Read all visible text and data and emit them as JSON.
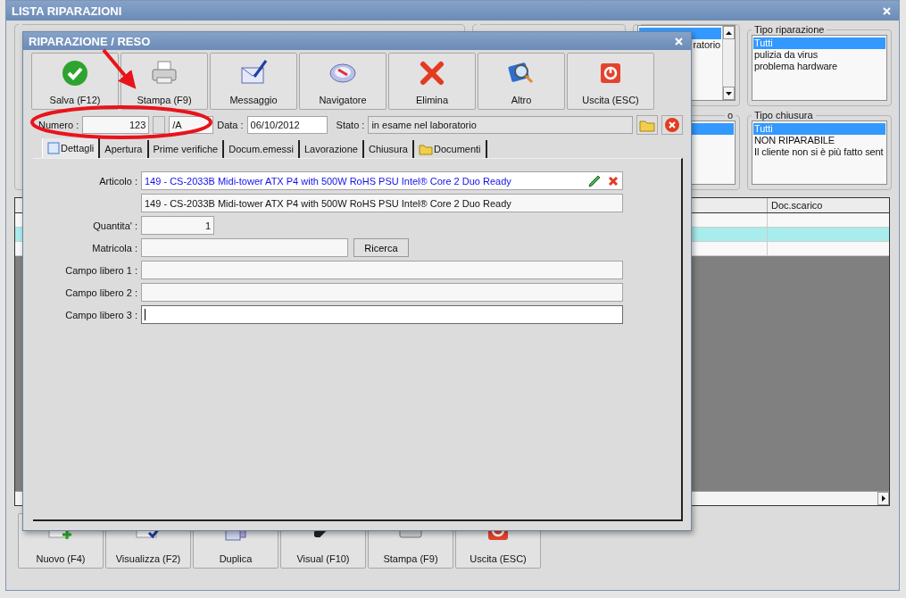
{
  "main_window": {
    "title": "LISTA RIPARAZIONI",
    "status_group": {
      "items": [
        {
          "selected": true
        },
        {
          "label": "ratorio",
          "selected": false
        }
      ]
    },
    "repair_type_group": {
      "title": "Tipo riparazione",
      "items": [
        {
          "label": "Tutti",
          "selected": true
        },
        {
          "label": "pulizia da virus",
          "selected": false
        },
        {
          "label": "problema hardware",
          "selected": false
        }
      ]
    },
    "second_group": {
      "title": "o",
      "items": [
        {
          "selected": true
        }
      ]
    },
    "closure_type_group": {
      "title": "Tipo chiusura",
      "items": [
        {
          "label": "Tutti",
          "selected": true
        },
        {
          "label": "NON RIPARABILE",
          "selected": false
        },
        {
          "label": "Il cliente non si è più fatto sent",
          "selected": false
        }
      ]
    },
    "table": {
      "columns": [
        {
          "label": "Doc.scarico"
        }
      ],
      "rows": [
        {
          "selected": false
        },
        {
          "selected": true
        },
        {
          "selected": false
        }
      ]
    },
    "toolbar": [
      {
        "label": "Nuovo (F4)"
      },
      {
        "label": "Visualizza (F2)"
      },
      {
        "label": "Duplica"
      },
      {
        "label": "Visual (F10)"
      },
      {
        "label": "Stampa (F9)"
      },
      {
        "label": "Uscita (ESC)"
      }
    ]
  },
  "dialog": {
    "title": "RIPARAZIONE / RESO",
    "toolbar": [
      {
        "label": "Salva (F12)"
      },
      {
        "label": "Stampa (F9)"
      },
      {
        "label": "Messaggio"
      },
      {
        "label": "Navigatore"
      },
      {
        "label": "Elimina"
      },
      {
        "label": "Altro"
      },
      {
        "label": "Uscita (ESC)"
      }
    ],
    "header": {
      "number_label": "Numero :",
      "number": "123",
      "suffix": "/A",
      "date_label": "Data :",
      "date": "06/10/2012",
      "status_label": "Stato :",
      "status": "in esame nel laboratorio"
    },
    "tabs": [
      {
        "label": "Dettagli",
        "selected": true
      },
      {
        "label": "Apertura",
        "selected": false
      },
      {
        "label": "Prime verifiche",
        "selected": false
      },
      {
        "label": "Docum.emessi",
        "selected": false
      },
      {
        "label": "Lavorazione",
        "selected": false
      },
      {
        "label": "Chiusura",
        "selected": false
      },
      {
        "label": "Documenti",
        "selected": false
      }
    ],
    "fields": [
      {
        "kind": "article",
        "label": "Articolo :",
        "value": "149 - CS-2033B Midi-tower ATX P4 with 500W RoHS PSU Intel® Core 2 Duo Ready"
      },
      {
        "kind": "description",
        "value": "149 - CS-2033B Midi-tower ATX P4 with 500W RoHS PSU Intel® Core 2 Duo Ready"
      },
      {
        "kind": "quantity",
        "label": "Quantita' :",
        "value": "1"
      },
      {
        "kind": "search",
        "label": "Matricola :",
        "button": "Ricerca"
      },
      {
        "kind": "text",
        "label": "Campo libero 1 :",
        "focused": false
      },
      {
        "kind": "text",
        "label": "Campo libero 2 :",
        "focused": false
      },
      {
        "kind": "text",
        "label": "Campo libero 3 :",
        "focused": true
      }
    ]
  }
}
